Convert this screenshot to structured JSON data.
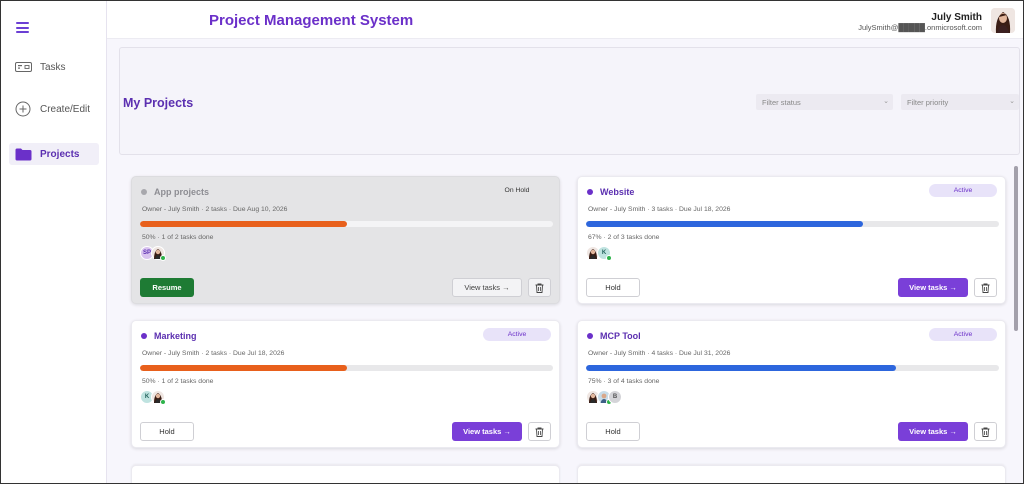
{
  "header": {
    "app_title": "Project Management System",
    "user_name": "July Smith",
    "user_email": "JulySmith@█████.onmicrosoft.com"
  },
  "sidebar": {
    "items": [
      {
        "label": "Tasks",
        "icon": "ticket-icon"
      },
      {
        "label": "Create/Edit",
        "icon": "plus-circle-icon"
      },
      {
        "label": "Projects",
        "icon": "folder-icon",
        "active": true
      }
    ]
  },
  "main": {
    "title": "My Projects",
    "filter_status": "Filter status",
    "filter_priority": "Filter priority"
  },
  "colors": {
    "accent": "#6b30c9",
    "progress_orange": "#e8601c",
    "progress_blue": "#2d66dd",
    "resume_green": "#1e7b34"
  },
  "projects": [
    {
      "name": "App projects",
      "status": "On Hold",
      "meta": "Owner - July Smith · 2 tasks · Due Aug 10, 2026",
      "progress": 50,
      "progress_text": "50% · 1 of 2 tasks done",
      "avatars": [
        "SP",
        "photo"
      ],
      "primary_action": "Resume",
      "view_label": "View tasks →"
    },
    {
      "name": "Website",
      "status": "Active",
      "meta": "Owner - July Smith · 3 tasks · Due Jul 18, 2026",
      "progress": 67,
      "progress_text": "67% · 2 of 3 tasks done",
      "avatars": [
        "photo",
        "K"
      ],
      "primary_action": "Hold",
      "view_label": "View tasks →"
    },
    {
      "name": "Marketing",
      "status": "Active",
      "meta": "Owner - July Smith · 2 tasks · Due Jul 18, 2026",
      "progress": 50,
      "progress_text": "50% · 1 of 2 tasks done",
      "avatars": [
        "K",
        "photo"
      ],
      "primary_action": "Hold",
      "view_label": "View tasks →"
    },
    {
      "name": "MCP Tool",
      "status": "Active",
      "meta": "Owner - July Smith · 4 tasks · Due Jul 31, 2026",
      "progress": 75,
      "progress_text": "75% · 3 of 4 tasks done",
      "avatars": [
        "photo",
        "photo",
        "B"
      ],
      "primary_action": "Hold",
      "view_label": "View tasks →"
    }
  ]
}
